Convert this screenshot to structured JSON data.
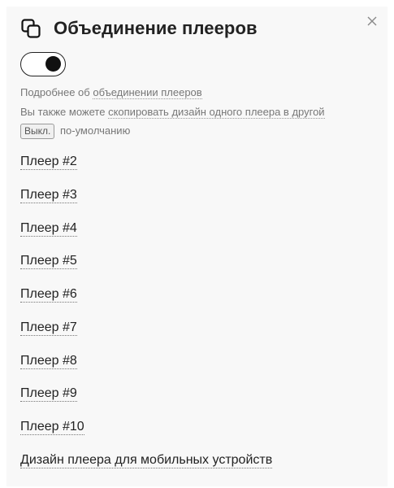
{
  "header": {
    "title": "Объединение плееров",
    "icon": "copy-icon",
    "close_icon": "close-icon"
  },
  "toggle": {
    "state": "on"
  },
  "info": {
    "line1_prefix": "Подробнее об",
    "line1_link": "объединении плееров",
    "line2_prefix": "Вы также можете",
    "line2_link": "скопировать дизайн одного плеера в другой",
    "line3_badge": "Выкл.",
    "line3_suffix": "по-умолчанию"
  },
  "players": [
    {
      "label": "Плеер #2"
    },
    {
      "label": "Плеер #3"
    },
    {
      "label": "Плеер #4"
    },
    {
      "label": "Плеер #5"
    },
    {
      "label": "Плеер #6"
    },
    {
      "label": "Плеер #7"
    },
    {
      "label": "Плеер #8"
    },
    {
      "label": "Плеер #9"
    },
    {
      "label": "Плеер #10"
    },
    {
      "label": "Дизайн плеера для мобильных устройств"
    }
  ],
  "colors": {
    "panel_bg": "#f8f8f8",
    "text": "#222222",
    "muted_text": "#777777"
  }
}
